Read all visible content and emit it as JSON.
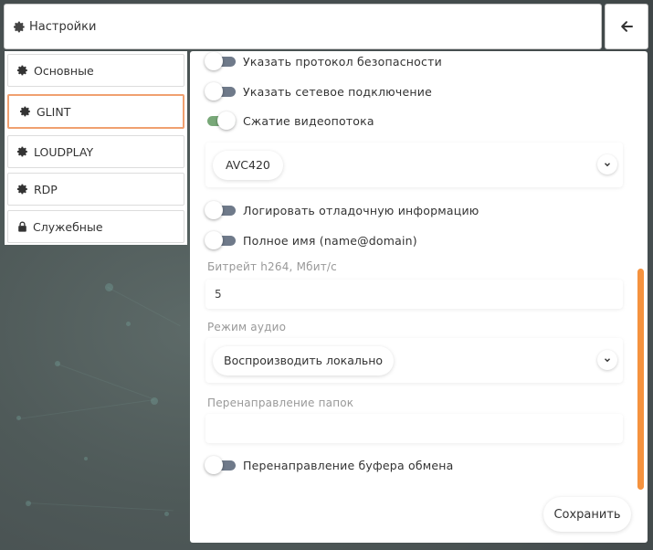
{
  "header": {
    "title": "Настройки",
    "icon": "gear-icon",
    "back_icon": "arrow-left-icon"
  },
  "sidebar": {
    "items": [
      {
        "label": "Основные",
        "icon": "gear-icon",
        "active": false
      },
      {
        "label": "GLINT",
        "icon": "gear-icon",
        "active": true
      },
      {
        "label": "LOUDPLAY",
        "icon": "gear-icon",
        "active": false
      },
      {
        "label": "RDP",
        "icon": "gear-icon",
        "active": false
      },
      {
        "label": "Служебные",
        "icon": "lock-icon",
        "active": false
      }
    ]
  },
  "settings": {
    "toggles": [
      {
        "label": "Указать протокол безопасности",
        "on": false
      },
      {
        "label": "Указать сетевое подключение",
        "on": false
      },
      {
        "label": "Сжатие видеопотока",
        "on": true
      },
      {
        "label": "Логировать отладочную информацию",
        "on": false
      },
      {
        "label": "Полное имя (name@domain)",
        "on": false
      },
      {
        "label": "Перенаправление буфера обмена",
        "on": false
      }
    ],
    "codec_select": {
      "value": "AVC420"
    },
    "bitrate": {
      "label": "Битрейт h264, Мбит/с",
      "value": "5"
    },
    "audio": {
      "label": "Режим аудио",
      "value": "Воспроизводить локально"
    },
    "folders": {
      "label": "Перенаправление папок",
      "value": ""
    },
    "save_label": "Сохранить"
  },
  "colors": {
    "accent": "#f5923e",
    "active_border": "#f0a070",
    "toggle_on": "#78a878",
    "toggle_off": "#6f7a8a"
  }
}
